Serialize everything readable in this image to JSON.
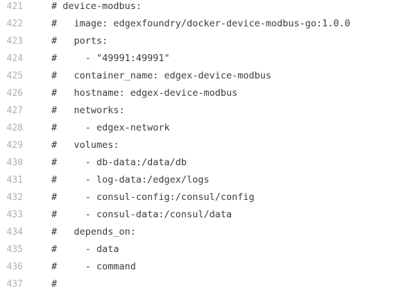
{
  "editor": {
    "lines": [
      {
        "number": "421",
        "code": "# device-modbus:"
      },
      {
        "number": "422",
        "code": "#   image: edgexfoundry/docker-device-modbus-go:1.0.0"
      },
      {
        "number": "423",
        "code": "#   ports:"
      },
      {
        "number": "424",
        "code": "#     - \"49991:49991\""
      },
      {
        "number": "425",
        "code": "#   container_name: edgex-device-modbus"
      },
      {
        "number": "426",
        "code": "#   hostname: edgex-device-modbus"
      },
      {
        "number": "427",
        "code": "#   networks:"
      },
      {
        "number": "428",
        "code": "#     - edgex-network"
      },
      {
        "number": "429",
        "code": "#   volumes:"
      },
      {
        "number": "430",
        "code": "#     - db-data:/data/db"
      },
      {
        "number": "431",
        "code": "#     - log-data:/edgex/logs"
      },
      {
        "number": "432",
        "code": "#     - consul-config:/consul/config"
      },
      {
        "number": "433",
        "code": "#     - consul-data:/consul/data"
      },
      {
        "number": "434",
        "code": "#   depends_on:"
      },
      {
        "number": "435",
        "code": "#     - data"
      },
      {
        "number": "436",
        "code": "#     - command"
      },
      {
        "number": "437",
        "code": "#"
      }
    ]
  }
}
